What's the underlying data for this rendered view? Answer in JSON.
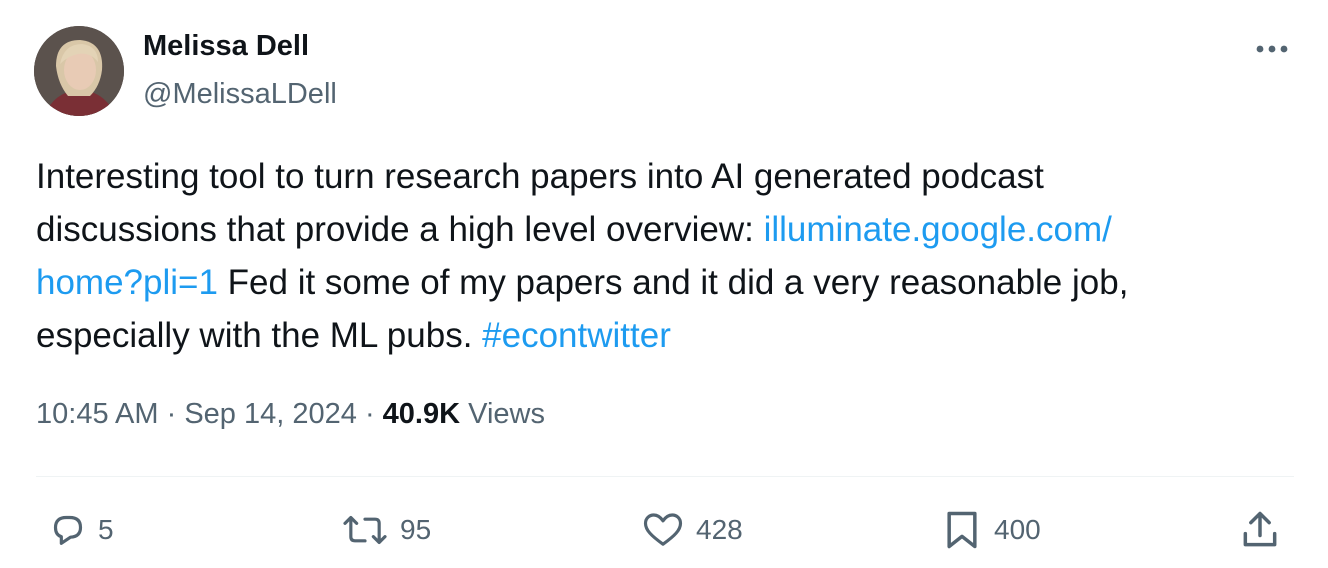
{
  "author": {
    "display_name": "Melissa Dell",
    "handle": "@MelissaLDell"
  },
  "tweet": {
    "line1": "Interesting tool to turn research papers into AI generated podcast",
    "line2_text": "discussions that provide a high level overview: ",
    "link_part1": "illuminate.google.com/",
    "link_part2": "home?pli=1",
    "line3_text": " Fed it some of my papers and it did a very reasonable job,",
    "line4_text": "especially with the ML pubs. ",
    "hashtag": "#econtwitter"
  },
  "meta": {
    "time": "10:45 AM",
    "separator": "·",
    "date": "Sep 14, 2024",
    "views_count": "40.9K",
    "views_label": "Views"
  },
  "actions": {
    "replies": "5",
    "reposts": "95",
    "likes": "428",
    "bookmarks": "400"
  },
  "colors": {
    "link": "#1d9bf0",
    "text": "#0f1419",
    "secondary": "#536471"
  },
  "icons": [
    "more-icon",
    "reply-icon",
    "retweet-icon",
    "like-icon",
    "bookmark-icon",
    "share-icon"
  ]
}
